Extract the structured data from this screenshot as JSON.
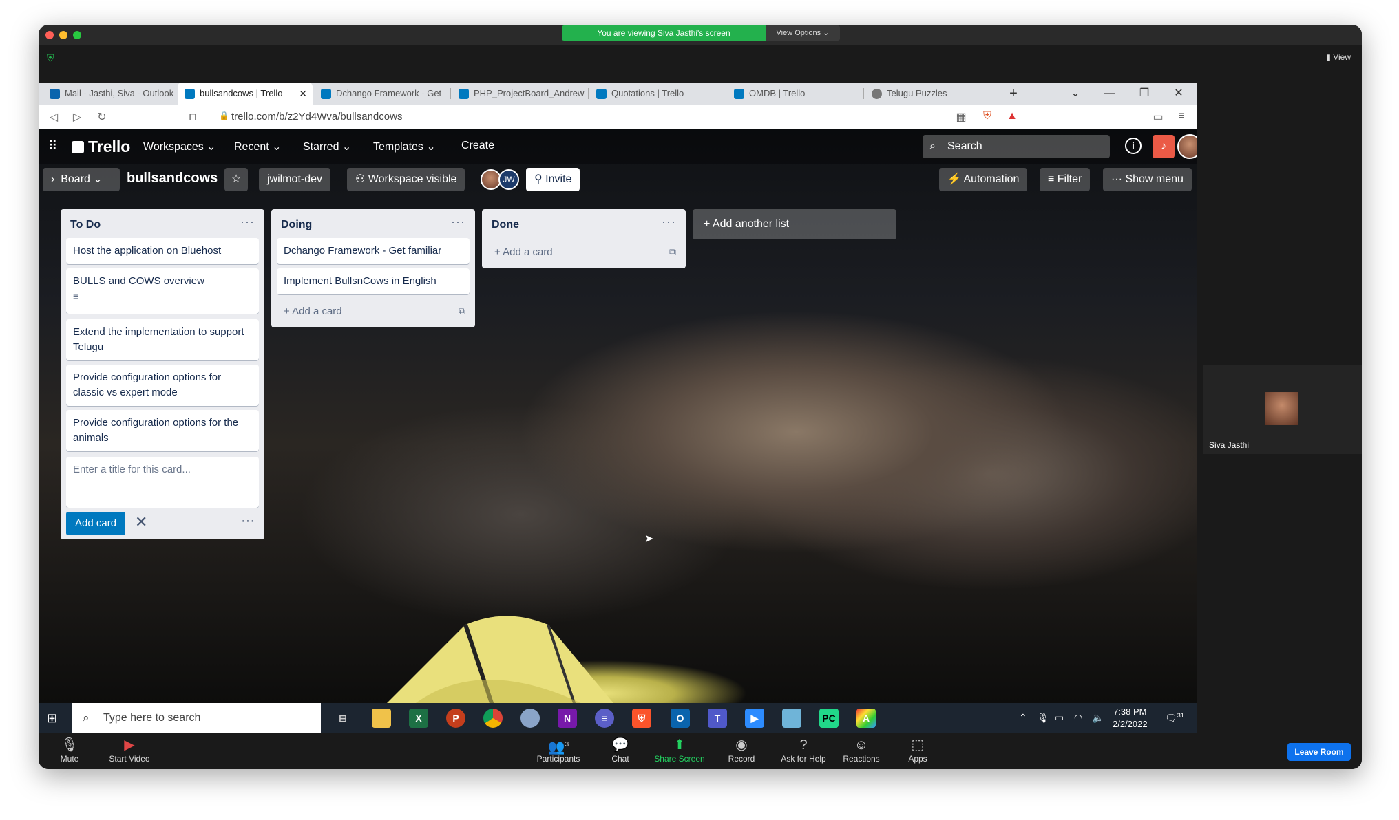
{
  "zoom": {
    "share_banner": "You are viewing Siva Jasthi's screen",
    "view_options": "View Options ⌄",
    "view_label": "View",
    "participant_name": "Siva Jasthi",
    "participants_count": "3",
    "toolbar": {
      "mute": "Mute",
      "start_video": "Start Video",
      "participants": "Participants",
      "chat": "Chat",
      "share_screen": "Share Screen",
      "record": "Record",
      "ask_for_help": "Ask for Help",
      "reactions": "Reactions",
      "apps": "Apps",
      "leave_room": "Leave Room"
    }
  },
  "browser": {
    "tabs": [
      {
        "title": "Mail - Jasthi, Siva - Outlook",
        "favicon_color": "#0a64ad"
      },
      {
        "title": "bullsandcows | Trello",
        "favicon_color": "#0079bf"
      },
      {
        "title": "Dchango Framework - Get",
        "favicon_color": "#0079bf"
      },
      {
        "title": "PHP_ProjectBoard_Andrew",
        "favicon_color": "#0079bf"
      },
      {
        "title": "Quotations | Trello",
        "favicon_color": "#0079bf"
      },
      {
        "title": "OMDB | Trello",
        "favicon_color": "#0079bf"
      },
      {
        "title": "Telugu Puzzles",
        "favicon_color": "#777777"
      }
    ],
    "url": "trello.com/b/z2Yd4Wva/bullsandcows"
  },
  "trello": {
    "logo": "Trello",
    "nav": {
      "workspaces": "Workspaces ⌄",
      "recent": "Recent ⌄",
      "starred": "Starred ⌄",
      "templates": "Templates ⌄",
      "create": "Create"
    },
    "search_placeholder": "Search",
    "board": {
      "view": "Board ⌄",
      "title": "bullsandcows",
      "workspace": "jwilmot-dev",
      "visibility": "Workspace visible",
      "avatar_initials": "JW",
      "invite": "Invite",
      "automation": "Automation",
      "filter": "Filter",
      "show_menu": "Show menu"
    },
    "lists": [
      {
        "title": "To Do",
        "cards": [
          "Host the application on Bluehost",
          "BULLS and COWS overview",
          "Extend the implementation to support Telugu",
          "Provide configuration options for classic vs expert mode",
          "Provide configuration options for the animals"
        ],
        "composer_placeholder": "Enter a title for this card...",
        "add_card_button": "Add card"
      },
      {
        "title": "Doing",
        "cards": [
          "Dchango Framework - Get familiar",
          "Implement BullsnCows in English"
        ],
        "add_card": "+ Add a card"
      },
      {
        "title": "Done",
        "cards": [],
        "add_card": "+ Add a card"
      }
    ],
    "add_another_list": "+ Add another list"
  },
  "taskbar": {
    "search_placeholder": "Type here to search",
    "time": "7:38 PM",
    "date": "2/2/2022",
    "notification_count": "31"
  }
}
